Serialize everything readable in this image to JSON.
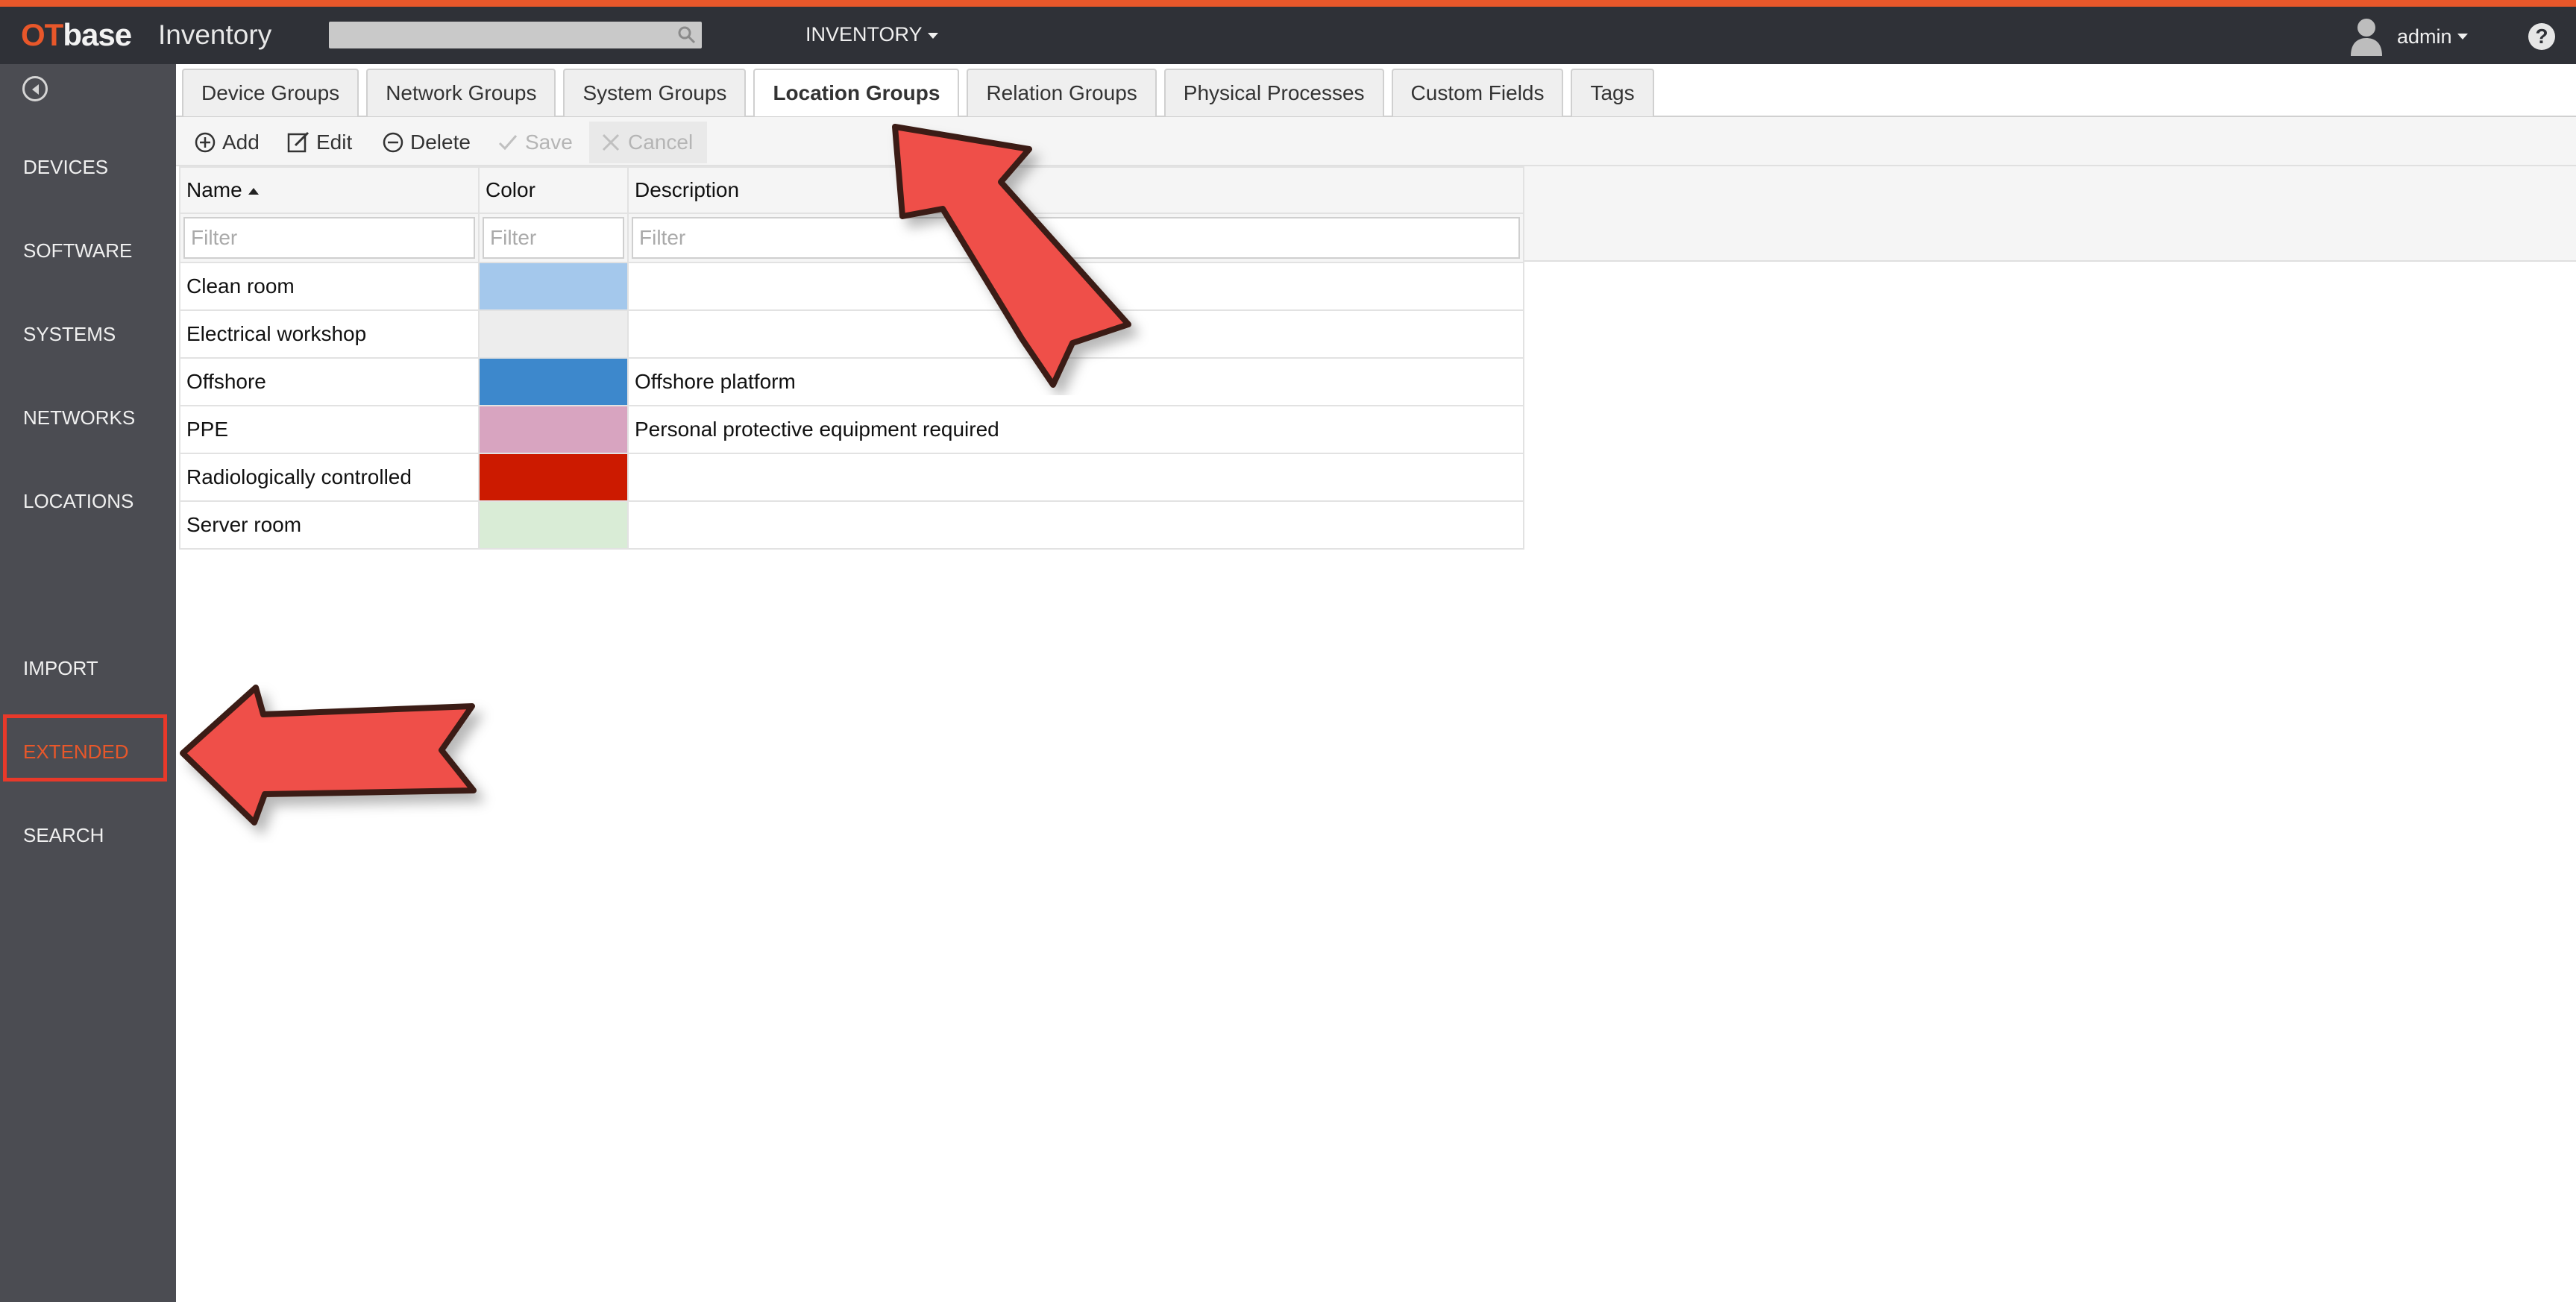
{
  "header": {
    "logo_ot": "OT",
    "logo_base": "base",
    "app_title": "Inventory",
    "search_placeholder": "",
    "nav_inventory": "INVENTORY",
    "user_name": "admin",
    "help_symbol": "?"
  },
  "sidebar": {
    "items": [
      {
        "label": "DEVICES"
      },
      {
        "label": "SOFTWARE"
      },
      {
        "label": "SYSTEMS"
      },
      {
        "label": "NETWORKS"
      },
      {
        "label": "LOCATIONS"
      },
      {
        "label": "IMPORT"
      },
      {
        "label": "EXTENDED"
      },
      {
        "label": "SEARCH"
      }
    ],
    "active_color": "#e8572a"
  },
  "tabs": [
    {
      "label": "Device Groups"
    },
    {
      "label": "Network Groups"
    },
    {
      "label": "System Groups"
    },
    {
      "label": "Location Groups"
    },
    {
      "label": "Relation Groups"
    },
    {
      "label": "Physical Processes"
    },
    {
      "label": "Custom Fields"
    },
    {
      "label": "Tags"
    }
  ],
  "toolbar": {
    "add_label": "Add",
    "edit_label": "Edit",
    "delete_label": "Delete",
    "save_label": "Save",
    "cancel_label": "Cancel"
  },
  "grid": {
    "columns": [
      {
        "label": "Name"
      },
      {
        "label": "Color"
      },
      {
        "label": "Description"
      }
    ],
    "filter_placeholder": "Filter",
    "rows": [
      {
        "name": "Clean room",
        "color": "#a4c8ec",
        "description": ""
      },
      {
        "name": "Electrical workshop",
        "color": "#ededed",
        "description": ""
      },
      {
        "name": "Offshore",
        "color": "#3d88cc",
        "description": "Offshore platform"
      },
      {
        "name": "PPE",
        "color": "#d8a4c0",
        "description": "Personal protective equipment required"
      },
      {
        "name": "Radiologically controlled",
        "color": "#cc1a00",
        "description": ""
      },
      {
        "name": "Server room",
        "color": "#d9ecd6",
        "description": ""
      }
    ]
  },
  "colors": {
    "accent": "#e8572a",
    "topbar": "#2f3137",
    "sidebar": "#4b4c52",
    "annotation_arrow": "#ef4f4a"
  }
}
